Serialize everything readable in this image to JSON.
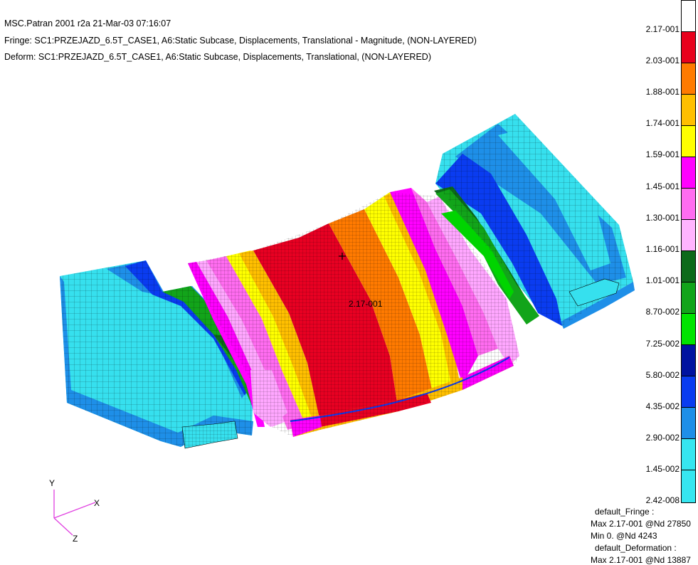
{
  "header": {
    "title": "MSC.Patran 2001 r2a 21-Mar-03 07:16:07",
    "fringe": "Fringe: SC1:PRZEJAZD_6.5T_CASE1, A6:Static Subcase, Displacements, Translational - Magnitude, (NON-LAYERED)",
    "deform": "Deform: SC1:PRZEJAZD_6.5T_CASE1, A6:Static Subcase, Displacements, Translational, (NON-LAYERED)"
  },
  "model": {
    "max_marker_label": "2.17-001",
    "colors": {
      "cyan": "#36e0ee",
      "light_blue": "#1e8fe8",
      "blue": "#0a3cf0",
      "dark_blue": "#0012a0",
      "green": "#00d400",
      "mid_green": "#12a41a",
      "dark_green": "#0d6a1a",
      "pink": "#ffa7ff",
      "violet": "#ff6cf0",
      "magenta": "#ff00ff",
      "yellow": "#ffff00",
      "amber": "#ffbf00",
      "orange": "#ff7a00",
      "red": "#e80022"
    }
  },
  "legend": {
    "colors": [
      "#ffffff",
      "#e8001c",
      "#ff7a00",
      "#ffbf00",
      "#ffff00",
      "#ff00ff",
      "#ff6cf0",
      "#ffb4ff",
      "#0d6a1a",
      "#12a41a",
      "#00e400",
      "#0012a0",
      "#0a3cf0",
      "#1e8fe8",
      "#36e6f0",
      "#36e6f0"
    ],
    "labels": [
      "2.17-001",
      "2.03-001",
      "1.88-001",
      "1.74-001",
      "1.59-001",
      "1.45-001",
      "1.30-001",
      "1.16-001",
      "1.01-001",
      "8.70-002",
      "7.25-002",
      "5.80-002",
      "4.35-002",
      "2.90-002",
      "1.45-002",
      "2.42-008"
    ]
  },
  "triad": {
    "x": "X",
    "y": "Y",
    "z": "Z",
    "color": "#e040e0"
  },
  "info": {
    "fringe_name": "default_Fringe :",
    "fringe_max": "Max 2.17-001 @Nd 27850",
    "fringe_min": "Min  0. @Nd 4243",
    "deform_name": "default_Deformation :",
    "deform_max": "Max 2.17-001 @Nd 13887"
  }
}
